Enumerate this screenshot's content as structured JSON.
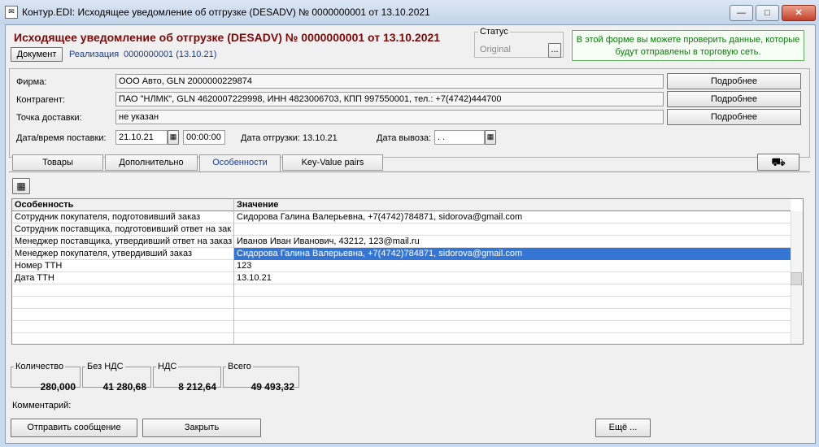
{
  "window": {
    "title": "Контур.EDI: Исходящее уведомление об отгрузке (DESADV) № 0000000001 от 13.10.2021",
    "minimize": "—",
    "maximize": "□",
    "close": "✕"
  },
  "header": {
    "doc_title": "Исходящее уведомление об отгрузке (DESADV) № 0000000001 от 13.10.2021",
    "document_button": "Документ",
    "realization_label": "Реализация",
    "realization_value": "0000000001 (13.10.21)",
    "status_legend": "Статус",
    "status_value": "Original",
    "status_button": "...",
    "info_text": "В этой форме вы можете проверить данные, которые будут отправлены в торговую сеть."
  },
  "form": {
    "firm_label": "Фирма:",
    "firm_value": "ООО Авто, GLN 2000000229874",
    "counterparty_label": "Контрагент:",
    "counterparty_value": "ПАО \"НЛМК\", GLN 4620007229998, ИНН 4823006703, КПП 997550001, тел.: +7(4742)444700",
    "delivery_point_label": "Точка доставки:",
    "delivery_point_value": "не указан",
    "details_button": "Подробнее",
    "delivery_date_label": "Дата/время поставки:",
    "delivery_date": "21.10.21",
    "delivery_time": "00:00:00",
    "shipment_date_label": "Дата отгрузки: 13.10.21",
    "export_date_label": "Дата вывоза:",
    "export_date_value": " .  ."
  },
  "tabs": [
    "Товары",
    "Дополнительно",
    "Особенности",
    "Key-Value pairs"
  ],
  "active_tab": "Особенности",
  "grid": {
    "headers": [
      "Особенность",
      "Значение"
    ],
    "rows": [
      [
        "Сотрудник покупателя, подготовивший заказ",
        "Сидорова Галина Валерьевна, +7(4742)784871, sidorova@gmail.com"
      ],
      [
        "Сотрудник поставщика, подготовивший ответ на зак",
        ""
      ],
      [
        "Менеджер поставщика, утвердивший ответ на заказ",
        "Иванов Иван Иванович, 43212, 123@mail.ru"
      ],
      [
        "Менеджер покупателя, утвердивший заказ",
        "Сидорова Галина Валерьевна, +7(4742)784871, sidorova@gmail.com"
      ],
      [
        "Номер ТТН",
        "123"
      ],
      [
        "Дата ТТН",
        "13.10.21"
      ]
    ],
    "selected_row": 3
  },
  "totals": {
    "quantity_label": "Количество",
    "quantity": "280,000",
    "no_vat_label": "Без НДС",
    "no_vat": "41 280,68",
    "vat_label": "НДС",
    "vat": "8 212,64",
    "total_label": "Всего",
    "total": "49 493,32"
  },
  "comment_label": "Комментарий:",
  "footer": {
    "send_button": "Отправить сообщение",
    "close_button": "Закрыть",
    "more_button": "Ещё ..."
  },
  "colors": {
    "highlight": "#f29a1e",
    "selection": "#3575d3",
    "title_red": "#7a0a0a",
    "info_green": "#0a7a0a"
  }
}
